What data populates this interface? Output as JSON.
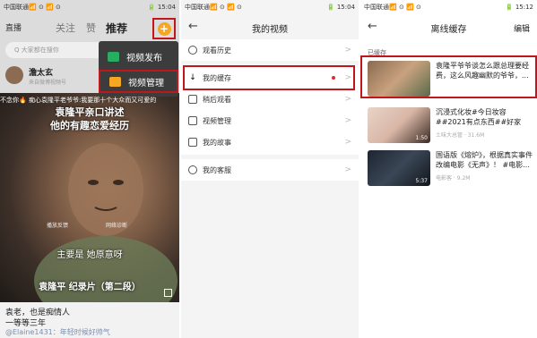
{
  "panel1": {
    "status_left": "中国联通📶 ⊙ 📶 ⊙",
    "status_right": "🔋 15:04",
    "logo": "直播",
    "tabs": [
      "关注",
      "赞",
      "推荐"
    ],
    "search_placeholder": "Q 大家都在搜你",
    "menu": [
      {
        "label": "视频发布",
        "color": "#27ae60"
      },
      {
        "label": "视频管理",
        "color": "#f5a623"
      }
    ],
    "user": {
      "name": "澹太玄",
      "sub": "来自微博视频号"
    },
    "scroll_caption": "不念你🔥   痴心袁隆平老爷爷:我要那十个大众而又可爱的",
    "video_title_line1": "袁隆平亲口讲述",
    "video_title_line2": "他的有趣恋爱经历",
    "video_controls": [
      "播放反馈",
      "网络诊断"
    ],
    "subtitle": "主要是 她原意呀",
    "bottom_caption": "袁隆平 纪录片（第二段）",
    "desc_line1": "袁老，也是痴情人",
    "desc_line2": "一等等三年",
    "comment": "@Elaine1431：年轻时候好帅气"
  },
  "panel2": {
    "status_left": "中国联通📶 ⊙ 📶 ⊙",
    "status_right": "🔋 15:04",
    "title": "我的视频",
    "items_group1": [
      "观看历史"
    ],
    "items_group2": [
      "我的缓存",
      "稍后观看",
      "视频管理",
      "我的故事"
    ],
    "items_group3": [
      "我的客服"
    ]
  },
  "panel3": {
    "status_left": "中国联通📶 ⊙ 📶 ⊙",
    "status_right": "🔋 15:12",
    "title": "离线缓存",
    "edit": "编辑",
    "section": "已缓存",
    "videos": [
      {
        "title": "袁隆平爷爷谈怎么跟总理要经费，这么风趣幽默的爷爷，...",
        "meta": "",
        "duration": ""
      },
      {
        "title": "沉浸式化妆#今日妆容##2021有点东西##好家伙...",
        "meta": "土味大总管 · 31.6M",
        "duration": "1:50"
      },
      {
        "title": "国语版《熔炉》，根据真实事件改编电影《无声》！ #电影...",
        "meta": "电影客 · 9.2M",
        "duration": "5:37"
      }
    ]
  },
  "colors": {
    "highlight": "#c0161c",
    "accent_orange": "#f5a623"
  }
}
